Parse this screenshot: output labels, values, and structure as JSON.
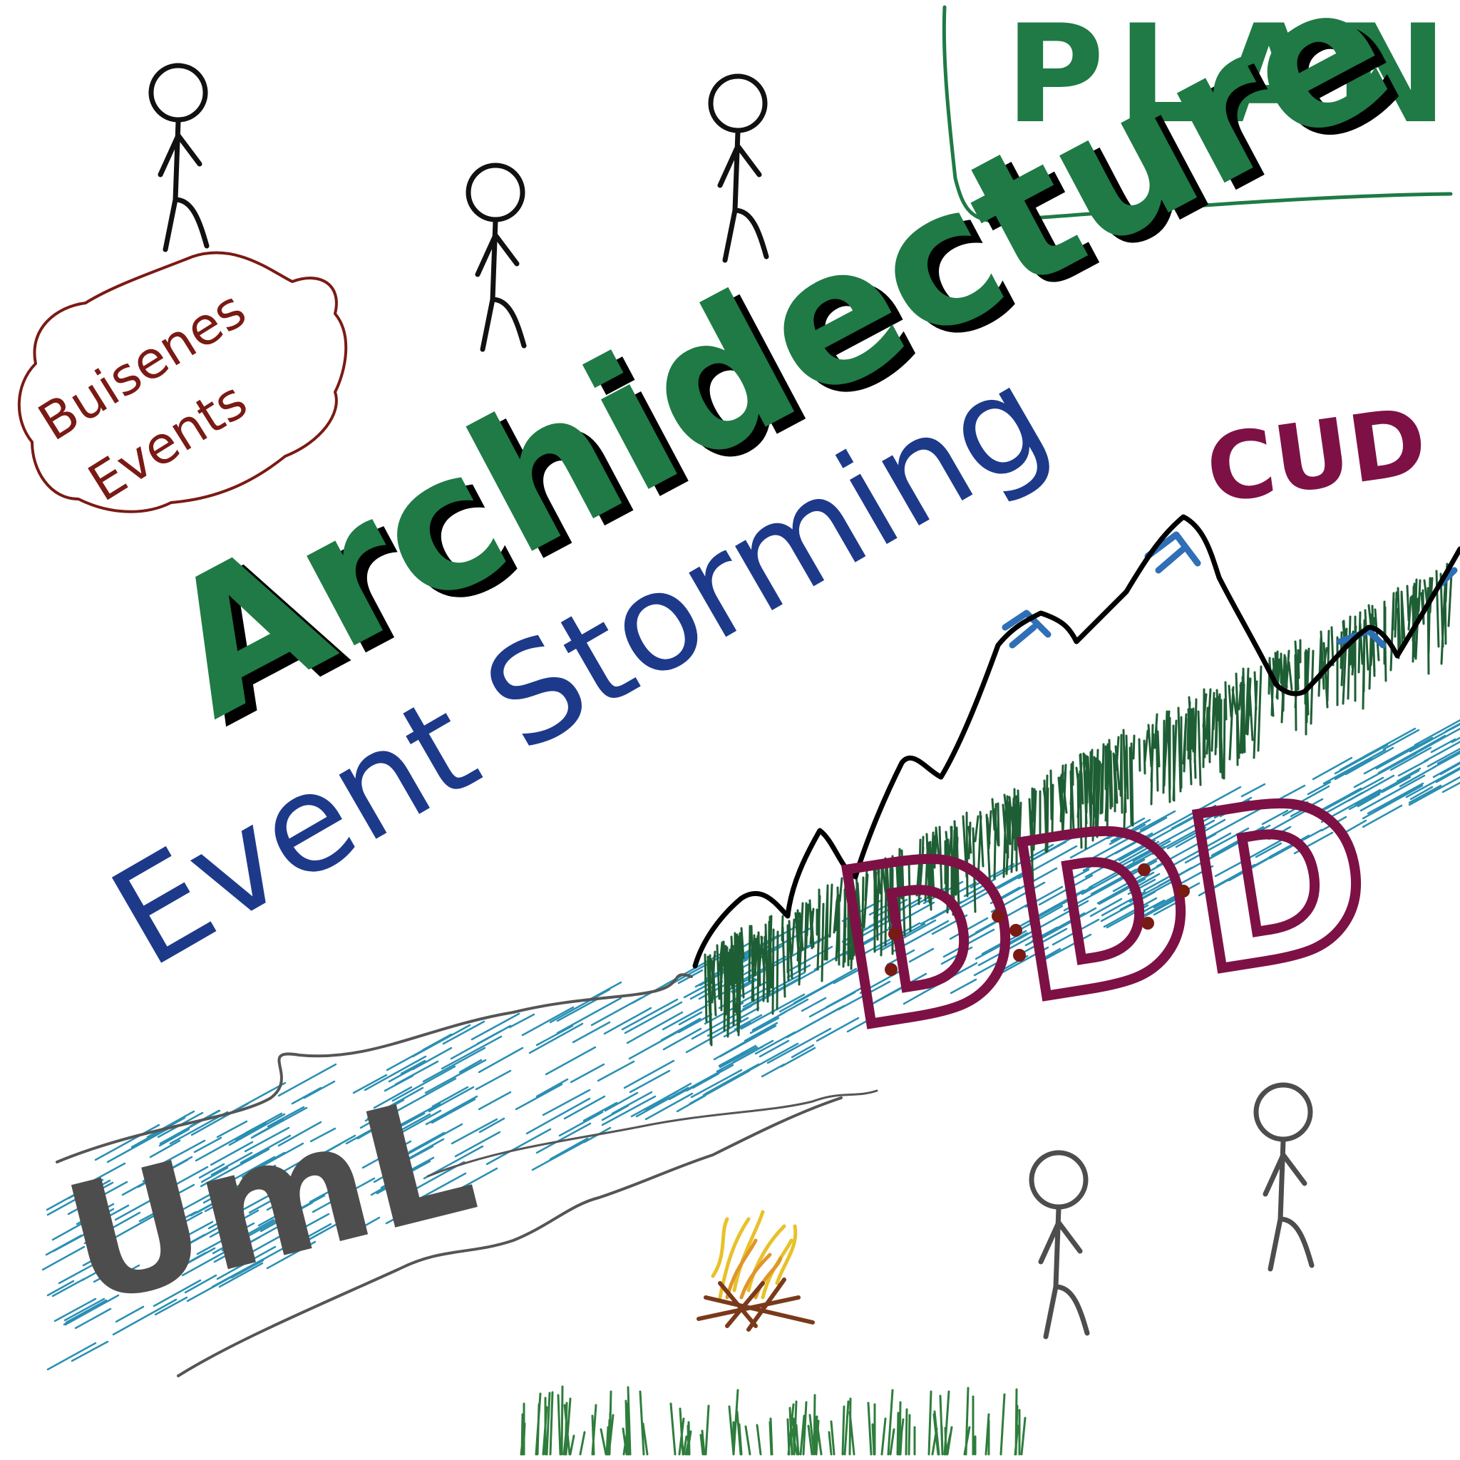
{
  "words": {
    "plan": "PLAN",
    "architecture": "Archidecture",
    "event_storming": "Event Storming",
    "cud": "CUD",
    "ddd": "DDD",
    "uml": "UmL",
    "business_events_line1": "Buisenes",
    "business_events_line2": "Events"
  },
  "colors": {
    "green": "#1f7a45",
    "green_shadow": "#000000",
    "navy": "#1d3a8a",
    "maroon": "#7d1145",
    "dark_red": "#7a1a14",
    "black": "#111111",
    "gray": "#4d4d4d",
    "water": "#2a8fb3",
    "mountain_green": "#1e5e34",
    "snow_blue": "#2f6fb8",
    "fire_orange": "#e0962a",
    "fire_yellow": "#e8c12b",
    "fire_brown": "#7a3a1a",
    "grass": "#2e7d3c"
  },
  "icons": {
    "figures": "stick-figure-icon",
    "fire": "campfire-icon",
    "mountains": "mountain-range-icon",
    "river": "river-icon"
  }
}
